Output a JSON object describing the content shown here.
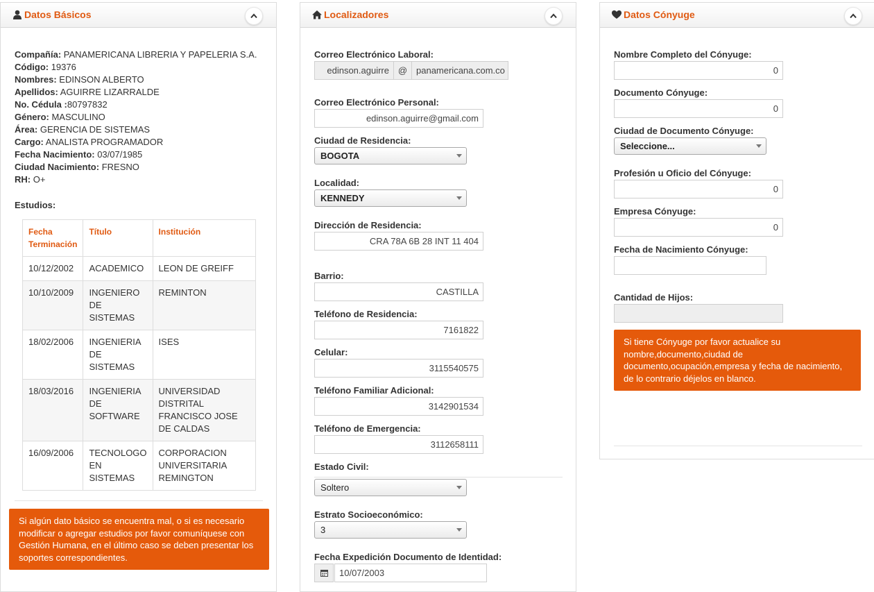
{
  "basic": {
    "title": "Datos Básicos",
    "info": [
      {
        "label": "Compañía:",
        "value": " PANAMERICANA LIBRERIA Y PAPELERIA S.A."
      },
      {
        "label": "Código:",
        "value": " 19376"
      },
      {
        "label": "Nombres:",
        "value": " EDINSON ALBERTO"
      },
      {
        "label": "Apellidos:",
        "value": " AGUIRRE LIZARRALDE"
      },
      {
        "label": "No. Cédula :",
        "value": "80797832"
      },
      {
        "label": "Género:",
        "value": " MASCULINO"
      },
      {
        "label": "Área:",
        "value": " GERENCIA DE SISTEMAS"
      },
      {
        "label": "Cargo:",
        "value": " ANALISTA PROGRAMADOR"
      },
      {
        "label": "Fecha Nacimiento:",
        "value": " 03/07/1985"
      },
      {
        "label": "Ciudad Nacimiento:",
        "value": " FRESNO"
      },
      {
        "label": "RH:",
        "value": " O+"
      }
    ],
    "studies_label": "Estudios:",
    "studies_headers": [
      "Fecha Terminación",
      "Título",
      "Institución"
    ],
    "studies": [
      [
        "10/12/2002",
        "ACADEMICO",
        "LEON DE GREIFF"
      ],
      [
        "10/10/2009",
        "INGENIERO DE SISTEMAS",
        "REMINTON"
      ],
      [
        "18/02/2006",
        "INGENIERIA DE SISTEMAS",
        "ISES"
      ],
      [
        "18/03/2016",
        "INGENIERIA DE SOFTWARE",
        "UNIVERSIDAD DISTRITAL FRANCISCO JOSE DE CALDAS"
      ],
      [
        "16/09/2006",
        "TECNOLOGO EN SISTEMAS",
        "CORPORACION UNIVERSITARIA REMINGTON"
      ]
    ],
    "alert": "Si algún dato básico se encuentra mal, o si es necesario modificar o agregar estudios por favor comuníquese con Gestión Humana, en el último caso se deben presentar los soportes correspondientes."
  },
  "locators": {
    "title": "Localizadores",
    "work_email_label": "Correo Electrónico Laboral:",
    "work_email_user": "edinson.aguirre",
    "work_email_at": "@",
    "work_email_domain": "panamericana.com.co",
    "personal_email_label": "Correo Electrónico Personal:",
    "personal_email": "edinson.aguirre@gmail.com",
    "city_label": "Ciudad de Residencia:",
    "city": "BOGOTA",
    "locality_label": "Localidad:",
    "locality": "KENNEDY",
    "address_label": "Dirección de Residencia:",
    "address": "CRA 78A 6B 28 INT 11 404",
    "neighborhood_label": "Barrio:",
    "neighborhood": "CASTILLA",
    "home_phone_label": "Teléfono de Residencia:",
    "home_phone": "7161822",
    "mobile_label": "Celular:",
    "mobile": "3115540575",
    "family_phone_label": "Teléfono Familiar Adicional:",
    "family_phone": "3142901534",
    "emergency_phone_label": "Teléfono de Emergencia:",
    "emergency_phone": "3112658111",
    "civil_status_label": "Estado Civil:",
    "civil_status": "Soltero",
    "stratum_label": "Estrato Socioeconómico:",
    "stratum": "3",
    "id_date_label": "Fecha Expedición Documento de Identidad:",
    "id_date": "10/07/2003"
  },
  "spouse": {
    "title": "Datos Cónyuge",
    "name_label": "Nombre Completo del Cónyuge:",
    "name": "0",
    "doc_label": "Documento Cónyuge:",
    "doc": "0",
    "doc_city_label": "Ciudad de Documento Cónyuge:",
    "doc_city": "Seleccione...",
    "profession_label": "Profesión u Oficio del Cónyuge:",
    "profession": "0",
    "company_label": "Empresa Cónyuge:",
    "company": "0",
    "birth_label": "Fecha de Nacimiento Cónyuge:",
    "birth": "",
    "children_label": "Cantidad de Hijos:",
    "children": "",
    "alert": "Si tiene Cónyuge por favor actualice su nombre,documento,ciudad de documento,ocupación,empresa y fecha de nacimiento, de lo contrario déjelos en blanco."
  },
  "colors": {
    "accent": "#e05a12",
    "alert_bg": "#e55a0b"
  },
  "icons": {
    "basic": "user-icon",
    "locators": "home-icon",
    "spouse": "heart-icon",
    "collapse": "chevron-up-icon",
    "date": "calendar-icon"
  }
}
